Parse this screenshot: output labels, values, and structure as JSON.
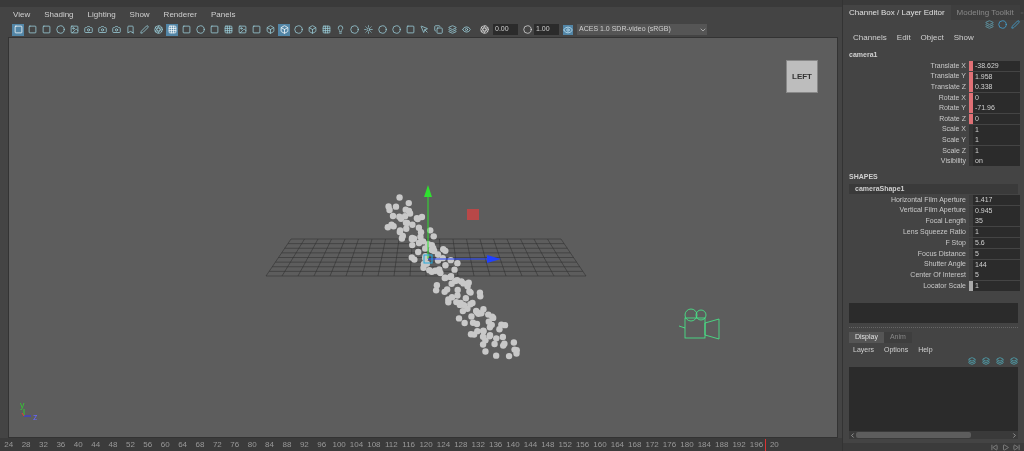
{
  "viewport_menu": [
    "View",
    "Shading",
    "Lighting",
    "Show",
    "Renderer",
    "Panels"
  ],
  "toolbar_buttons": [
    {
      "selected": true
    },
    {
      "selected": false
    },
    {
      "selected": false
    },
    {
      "selected": false
    },
    {
      "selected": false
    },
    {
      "selected": false
    },
    {
      "selected": false
    },
    {
      "selected": false
    },
    {
      "selected": false
    },
    {
      "selected": false
    },
    {
      "selected": false
    },
    {
      "selected": true
    },
    {
      "selected": false
    },
    {
      "selected": false
    },
    {
      "selected": false
    },
    {
      "selected": false
    },
    {
      "selected": false
    },
    {
      "selected": false
    },
    {
      "selected": false
    },
    {
      "selected": true
    },
    {
      "selected": false
    },
    {
      "selected": false
    },
    {
      "selected": false
    },
    {
      "selected": false
    },
    {
      "selected": false
    },
    {
      "selected": false
    },
    {
      "selected": false
    },
    {
      "selected": false
    },
    {
      "selected": false
    },
    {
      "selected": false
    },
    {
      "selected": false
    },
    {
      "selected": false
    },
    {
      "selected": false
    }
  ],
  "exposure": "0.00",
  "gamma": "1.00",
  "color_space": "ACES 1.0 SDR-video (sRGB)",
  "view_cube_label": "LEFT",
  "axis_labels": [
    "y",
    "z"
  ],
  "timeline_ticks": [
    "24",
    "28",
    "32",
    "36",
    "40",
    "44",
    "48",
    "52",
    "56",
    "60",
    "64",
    "68",
    "72",
    "76",
    "80",
    "84",
    "88",
    "92",
    "96",
    "100",
    "104",
    "108",
    "112",
    "116",
    "120",
    "124",
    "128",
    "132",
    "136",
    "140",
    "144",
    "148",
    "152",
    "156",
    "160",
    "164",
    "168",
    "172",
    "176",
    "180",
    "184",
    "188",
    "192",
    "196",
    "20"
  ],
  "panel_tabs": [
    {
      "label": "Channel Box / Layer Editor",
      "selected": true
    },
    {
      "label": "Modeling Toolkit",
      "selected": false
    }
  ],
  "channel_menu": [
    "Channels",
    "Edit",
    "Object",
    "Show"
  ],
  "node": "camera1",
  "channels": [
    {
      "name": "Translate X",
      "value": "-38.629",
      "keyed": true
    },
    {
      "name": "Translate Y",
      "value": "1.958",
      "keyed": true
    },
    {
      "name": "Translate Z",
      "value": "0.338",
      "keyed": true
    },
    {
      "name": "Rotate X",
      "value": "0",
      "keyed": true
    },
    {
      "name": "Rotate Y",
      "value": "-71.96",
      "keyed": true
    },
    {
      "name": "Rotate Z",
      "value": "0",
      "keyed": true
    },
    {
      "name": "Scale X",
      "value": "1",
      "keyed": false
    },
    {
      "name": "Scale Y",
      "value": "1",
      "keyed": false
    },
    {
      "name": "Scale Z",
      "value": "1",
      "keyed": false
    },
    {
      "name": "Visibility",
      "value": "on",
      "keyed": false
    }
  ],
  "shapes_header": "SHAPES",
  "shape_node": "cameraShape1",
  "shape_attributes": [
    {
      "name": "Horizontal Film Aperture",
      "value": "1.417",
      "kind": "number"
    },
    {
      "name": "Vertical Film Aperture",
      "value": "0.945",
      "kind": "number"
    },
    {
      "name": "Focal Length",
      "value": "35",
      "kind": "number"
    },
    {
      "name": "Lens Squeeze Ratio",
      "value": "1",
      "kind": "number"
    },
    {
      "name": "F Stop",
      "value": "5.6",
      "kind": "number"
    },
    {
      "name": "Focus Distance",
      "value": "5",
      "kind": "number"
    },
    {
      "name": "Shutter Angle",
      "value": "144",
      "kind": "number"
    },
    {
      "name": "Center Of Interest",
      "value": "5",
      "kind": "number"
    },
    {
      "name": "Locator Scale",
      "value": "1",
      "kind": "slider"
    }
  ],
  "layer_tabs": [
    {
      "label": "Display",
      "selected": true
    },
    {
      "label": "Anim",
      "selected": false
    }
  ],
  "layer_menu": [
    "Layers",
    "Options",
    "Help"
  ]
}
